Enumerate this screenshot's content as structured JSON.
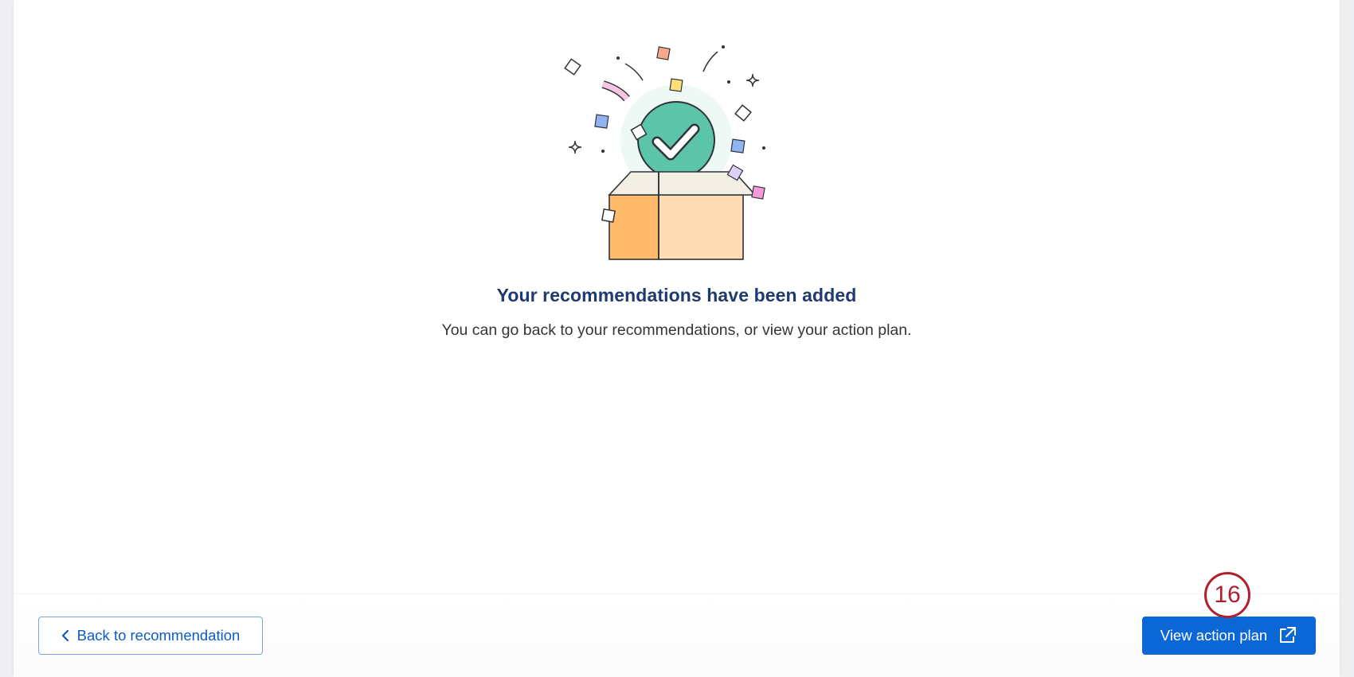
{
  "confirmation": {
    "title": "Your recommendations have been added",
    "message": "You can go back to your recommendations, or view your action plan."
  },
  "footer": {
    "back_label": "Back to recommendation",
    "primary_label": "View action plan"
  },
  "annotation": {
    "step_number": "16"
  },
  "icons": {
    "back": "chevron-left-icon",
    "external": "external-link-icon",
    "illustration": "success-box-illustration"
  },
  "colors": {
    "title": "#1e3a6e",
    "primary_button": "#0b66d6",
    "back_button_text": "#0b5cc4",
    "step_badge": "#b01f2e",
    "check_circle": "#5cc4a8"
  }
}
